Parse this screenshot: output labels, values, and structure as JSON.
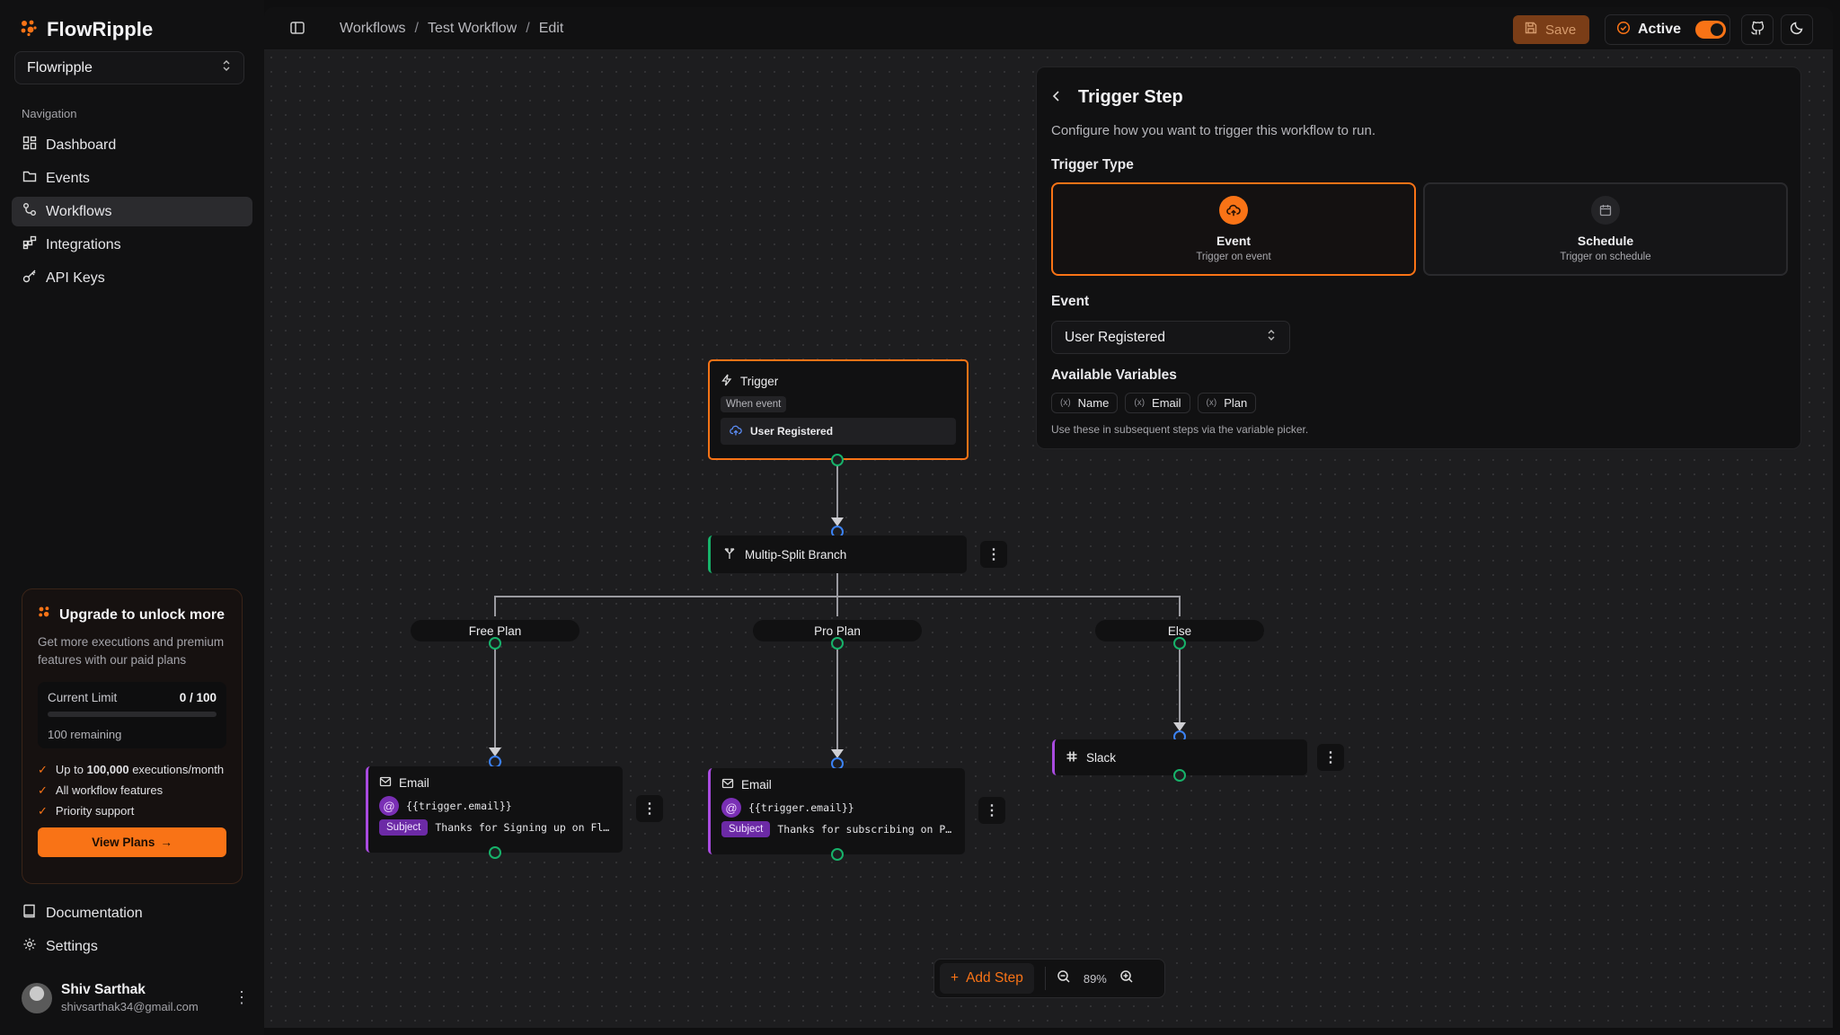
{
  "app": {
    "name": "FlowRipple",
    "workspace": "Flowripple"
  },
  "nav": {
    "label": "Navigation",
    "items": [
      {
        "label": "Dashboard"
      },
      {
        "label": "Events"
      },
      {
        "label": "Workflows"
      },
      {
        "label": "Integrations"
      },
      {
        "label": "API Keys"
      }
    ]
  },
  "upgrade": {
    "title": "Upgrade to unlock more",
    "desc": "Get more executions and premium features with our paid plans",
    "limit_label": "Current Limit",
    "limit_value": "0 / 100",
    "usage_fraction": 0,
    "remaining": "100 remaining",
    "features": [
      {
        "pre": "Up to ",
        "bold": "100,000",
        "post": " executions/month"
      },
      {
        "pre": "All workflow features",
        "bold": "",
        "post": ""
      },
      {
        "pre": "Priority support",
        "bold": "",
        "post": ""
      }
    ],
    "button": "View Plans"
  },
  "bottom_links": [
    {
      "label": "Documentation"
    },
    {
      "label": "Settings"
    }
  ],
  "user": {
    "name": "Shiv Sarthak",
    "email": "shivsarthak34@gmail.com"
  },
  "topbar": {
    "breadcrumbs": [
      "Workflows",
      "Test Workflow",
      "Edit"
    ],
    "save": "Save",
    "active": "Active"
  },
  "canvas": {
    "trigger": {
      "title": "Trigger",
      "chip": "When event",
      "event": "User Registered"
    },
    "branch": {
      "title": "Multip-Split Branch"
    },
    "branches": [
      "Free Plan",
      "Pro Plan",
      "Else"
    ],
    "email1": {
      "title": "Email",
      "to": "{{trigger.email}}",
      "subject_label": "Subject",
      "subject": "Thanks for Signing up on Fl…"
    },
    "email2": {
      "title": "Email",
      "to": "{{trigger.email}}",
      "subject_label": "Subject",
      "subject": "Thanks for subscribing on P…"
    },
    "slack": {
      "title": "Slack"
    }
  },
  "panel": {
    "title": "Trigger Step",
    "desc": "Configure how you want to trigger this workflow to run.",
    "type_label": "Trigger Type",
    "types": [
      {
        "name": "Event",
        "sub": "Trigger on event"
      },
      {
        "name": "Schedule",
        "sub": "Trigger on schedule"
      }
    ],
    "event_label": "Event",
    "event_value": "User Registered",
    "vars_label": "Available Variables",
    "vars": [
      "Name",
      "Email",
      "Plan"
    ],
    "hint": "Use these in subsequent steps via the variable picker."
  },
  "toolbar": {
    "add_step": "Add Step",
    "zoom": "89%"
  },
  "colors": {
    "accent": "#f97316",
    "success": "#17b26a",
    "purple": "#a94be0",
    "handle_blue": "#3b82f6"
  }
}
